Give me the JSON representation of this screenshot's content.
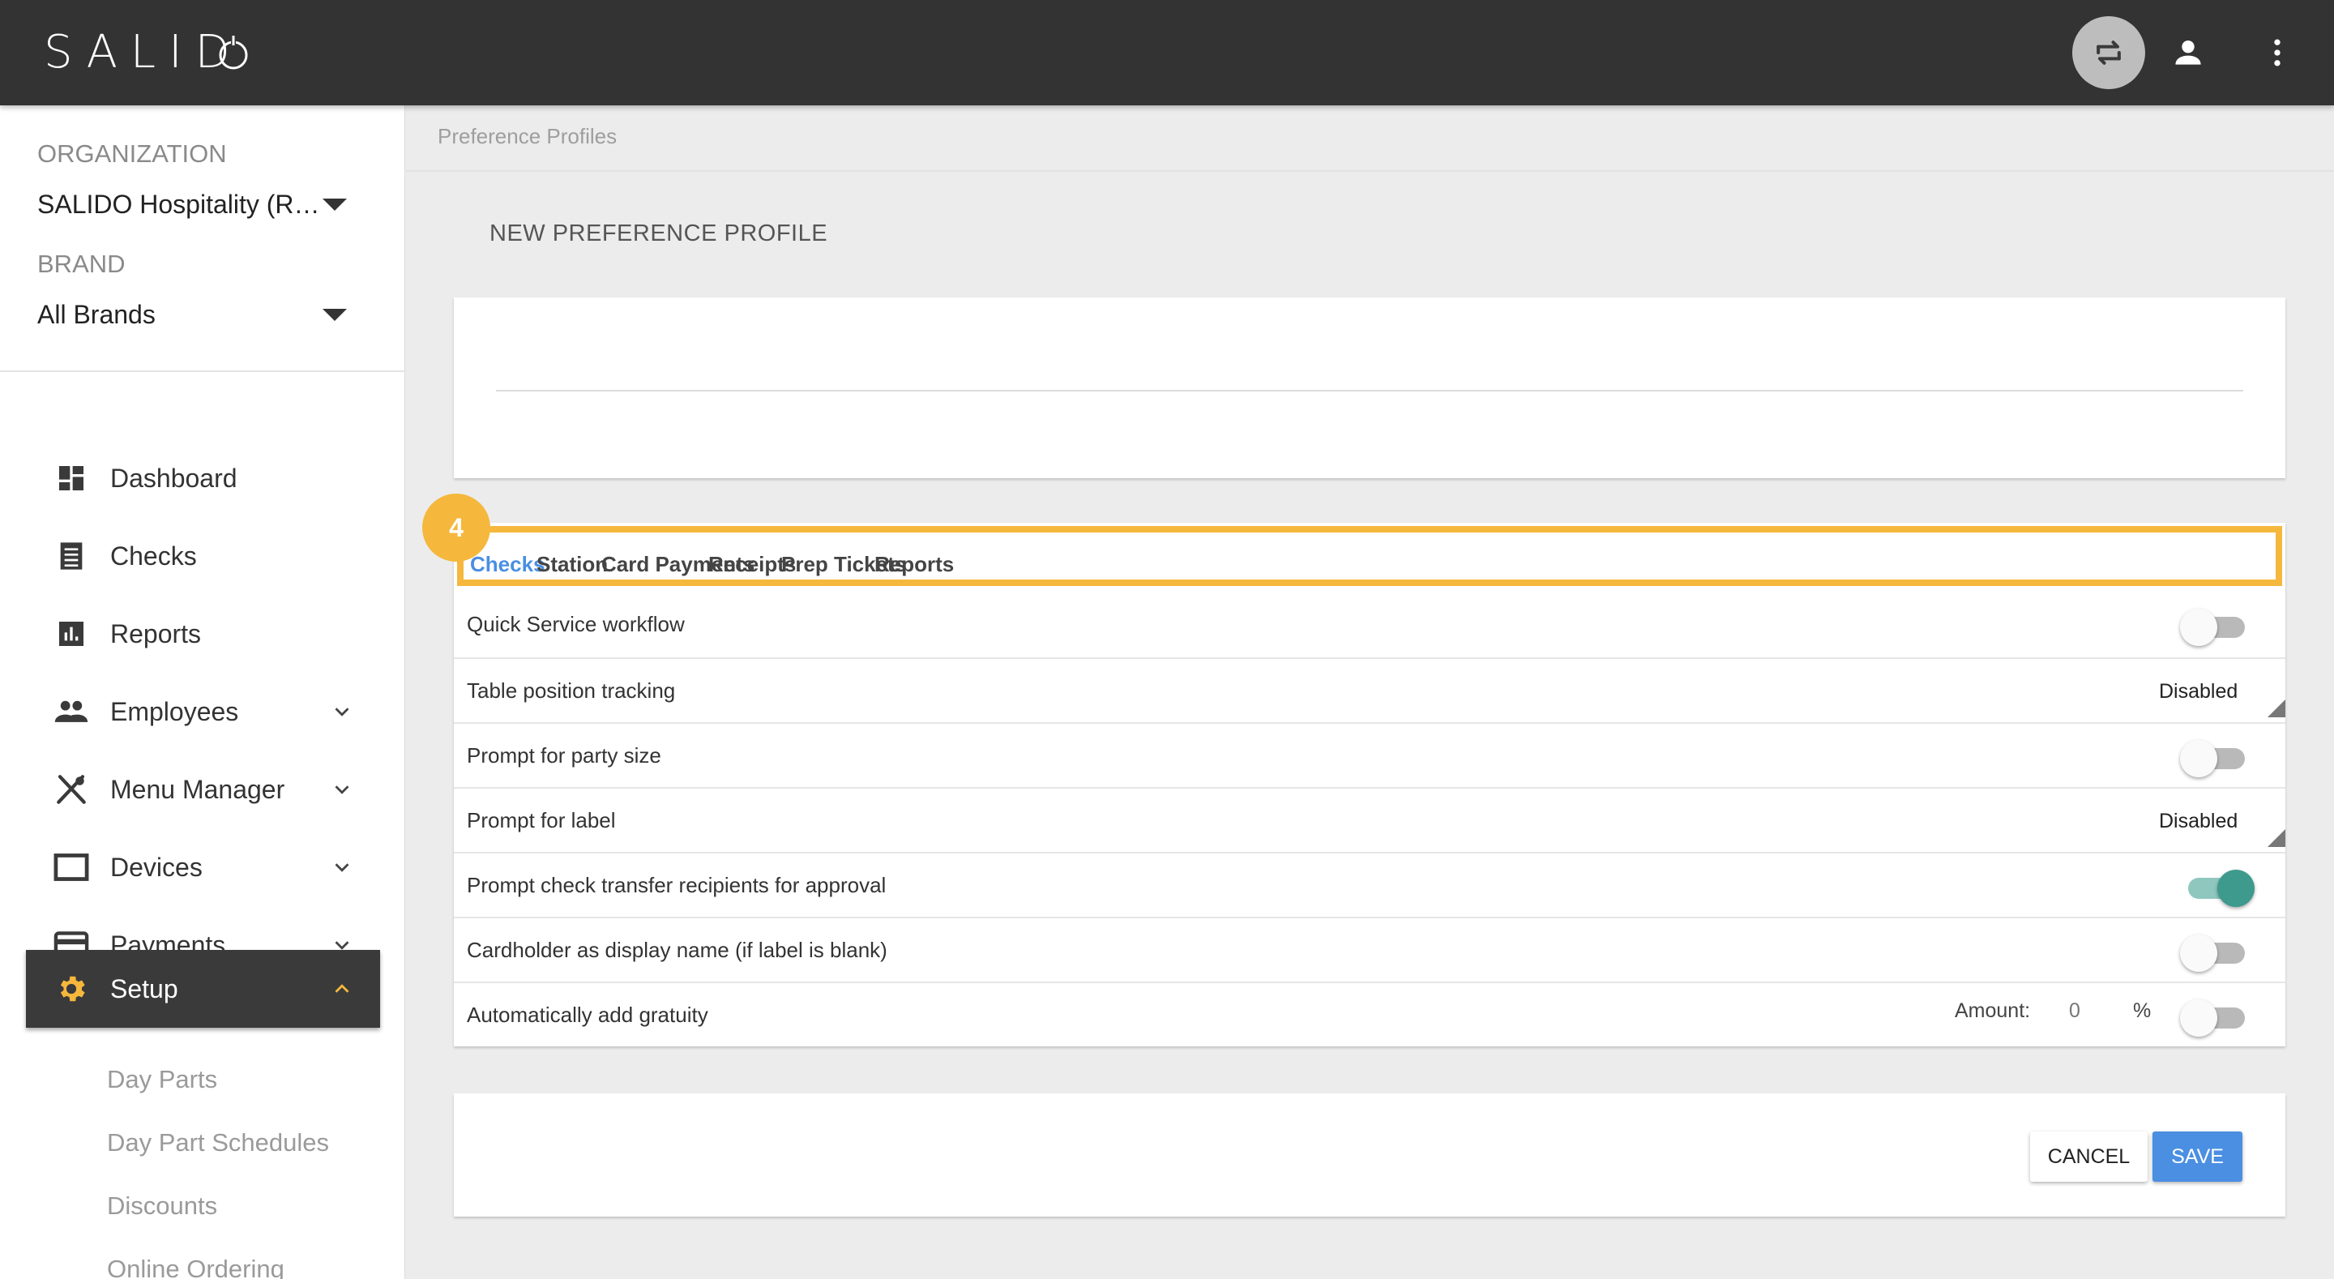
{
  "app": {
    "logo_text": "SALID",
    "logo_icon": "power-o-icon",
    "header_icons": [
      "swap-horiz-icon",
      "person-icon",
      "more-vert-icon"
    ]
  },
  "sidebar": {
    "organization_label": "ORGANIZATION",
    "organization_value": "SALIDO Hospitality (Re...",
    "brand_label": "BRAND",
    "brand_value": "All Brands",
    "nav": [
      {
        "label": "Dashboard",
        "icon": "dashboard-icon"
      },
      {
        "label": "Checks",
        "icon": "receipt-icon"
      },
      {
        "label": "Reports",
        "icon": "bar-chart-icon"
      },
      {
        "label": "Employees",
        "icon": "people-icon"
      },
      {
        "label": "Menu Manager",
        "icon": "utensils-icon"
      },
      {
        "label": "Devices",
        "icon": "tablet-icon"
      },
      {
        "label": "Payments",
        "icon": "credit-card-icon"
      },
      {
        "label": "Setup",
        "icon": "gear-icon"
      }
    ],
    "sub_items": [
      "Day Parts",
      "Day Part Schedules",
      "Discounts",
      "Online Ordering"
    ],
    "accent_color": "#f5b83d"
  },
  "main": {
    "breadcrumb": "Preference Profiles",
    "page_title": "NEW PREFERENCE PROFILE",
    "step_badge": "4",
    "tabs": [
      "Checks",
      "Station",
      "Card Payments",
      "Receipts",
      "Prep Tickets",
      "Reports"
    ],
    "active_tab": "Checks",
    "settings": [
      {
        "label": "Quick Service workflow",
        "type": "toggle",
        "on": false
      },
      {
        "label": "Table position tracking",
        "type": "select",
        "value": "Disabled"
      },
      {
        "label": "Prompt for party size",
        "type": "toggle",
        "on": false
      },
      {
        "label": "Prompt for label",
        "type": "select",
        "value": "Disabled"
      },
      {
        "label": "Prompt check transfer recipients for approval",
        "type": "toggle",
        "on": true
      },
      {
        "label": "Cardholder as display name (if label is blank)",
        "type": "toggle",
        "on": false
      },
      {
        "label": "Automatically add gratuity",
        "type": "toggle",
        "on": false
      }
    ],
    "gratuity": {
      "amount_label": "Amount:",
      "amount_value": "0",
      "unit": "%"
    },
    "buttons": {
      "cancel": "CANCEL",
      "save": "SAVE"
    },
    "colors": {
      "primary": "#4a8fe2",
      "toggle_on": "#3d9a8d",
      "highlight": "#f5b83d",
      "header_bg": "#333333"
    }
  }
}
